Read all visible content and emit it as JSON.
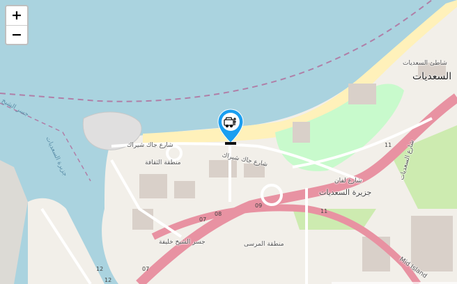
{
  "zoom": {
    "in_label": "+",
    "out_label": "−"
  },
  "labels": {
    "beach_name": "شاطئ السعديات",
    "island_name_top": "السعديات",
    "island_name_mid": "جزيرة السعديات",
    "culture_zone": "منطقة الثقافة",
    "marina_zone": "منطقة المرسى",
    "street_top": "شارع جاك شيراك",
    "street_mid": "شارع جاك شيراك",
    "street_east": "شارع لفان",
    "bridge": "جسر الشيخ خليفة",
    "water_1": "جزيرة السعديات",
    "water_2": "جسر الشيخ",
    "road_east": "شارع السعديات",
    "road_se": "Mid Island"
  },
  "shields": [
    "11",
    "11",
    "09",
    "08",
    "07",
    "07",
    "12",
    "12"
  ],
  "marker": {
    "icon": "museum-icon",
    "color": "#1a9ef0"
  },
  "colors": {
    "water": "#aad3df",
    "land": "#f2efe9",
    "beach": "#fff1ba",
    "motorway": "#e892a2",
    "park": "#c8facc"
  }
}
